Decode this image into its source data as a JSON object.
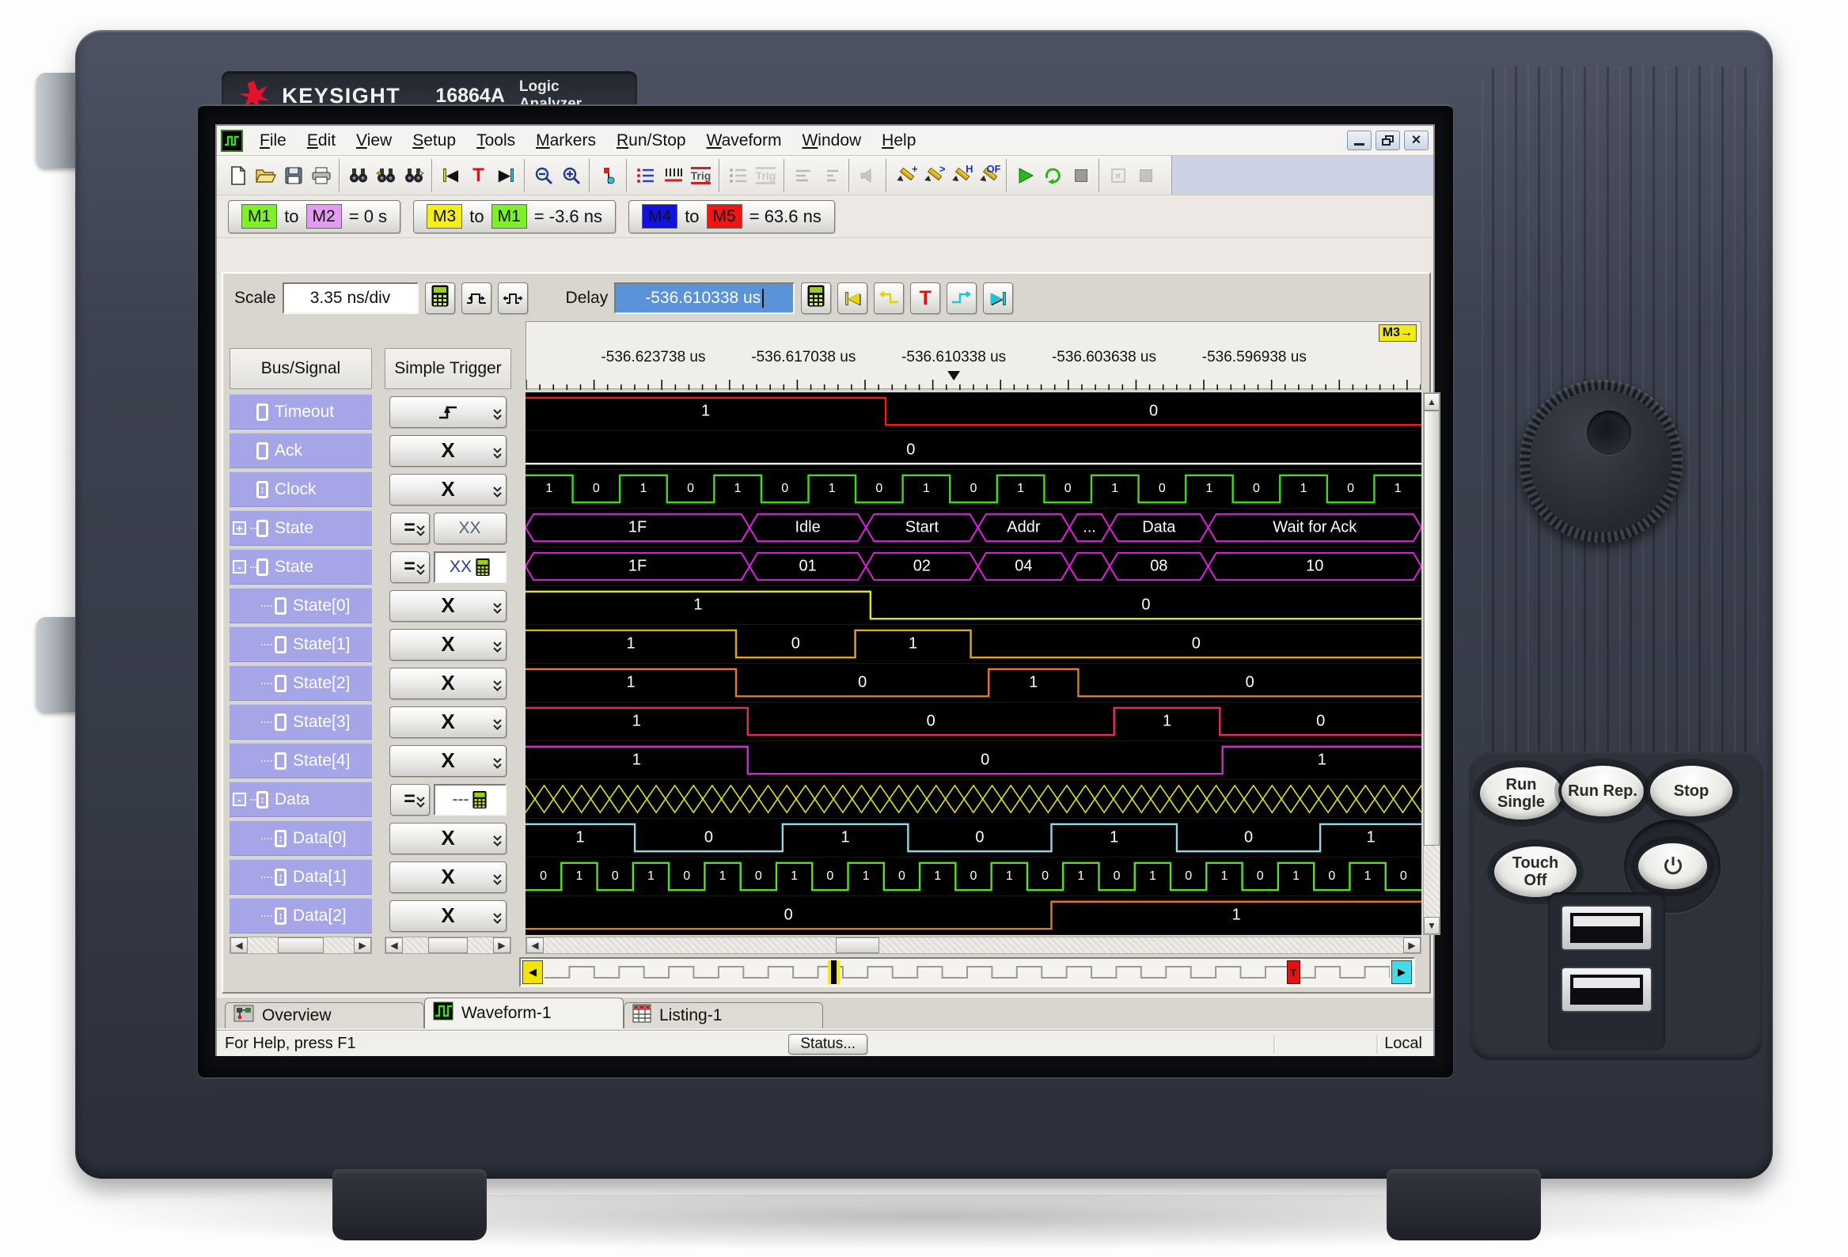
{
  "device": {
    "brand": "KEYSIGHT",
    "model": "16864A",
    "product": "Logic Analyzer",
    "hard_keys": [
      {
        "id": "run-single",
        "lines": [
          "Run",
          "Single"
        ]
      },
      {
        "id": "run-rep",
        "lines": [
          "Run Rep."
        ]
      },
      {
        "id": "stop",
        "lines": [
          "Stop"
        ]
      },
      {
        "id": "touch-off",
        "lines": [
          "Touch",
          "Off"
        ]
      }
    ]
  },
  "window": {
    "menu": [
      "File",
      "Edit",
      "View",
      "Setup",
      "Tools",
      "Markers",
      "Run/Stop",
      "Waveform",
      "Window",
      "Help"
    ],
    "window_controls": [
      "minimize",
      "restore",
      "close"
    ],
    "toolbar_groups": [
      {
        "disabled": false,
        "icons": [
          {
            "name": "new-file-icon"
          },
          {
            "name": "open-file-icon"
          },
          {
            "name": "save-icon"
          },
          {
            "name": "print-icon"
          }
        ]
      },
      {
        "disabled": false,
        "icons": [
          {
            "name": "find-icon"
          },
          {
            "name": "find-previous-icon"
          },
          {
            "name": "find-next-icon"
          }
        ]
      },
      {
        "disabled": false,
        "icons": [
          {
            "name": "goto-start-icon"
          },
          {
            "name": "goto-trigger-icon",
            "text": "T"
          },
          {
            "name": "goto-end-icon"
          }
        ]
      },
      {
        "disabled": false,
        "icons": [
          {
            "name": "zoom-out-icon"
          },
          {
            "name": "zoom-in-icon"
          }
        ]
      },
      {
        "disabled": false,
        "icons": [
          {
            "name": "marker-tool-icon"
          }
        ]
      },
      {
        "disabled": false,
        "icons": [
          {
            "name": "bus-signal-setup-icon"
          },
          {
            "name": "sampling-setup-icon"
          },
          {
            "name": "trigger-setup-icon",
            "text": "Trig"
          }
        ]
      },
      {
        "disabled": true,
        "icons": [
          {
            "name": "secondary-setup-disabled-icon"
          },
          {
            "name": "secondary-trigger-disabled-icon",
            "text": "Trig"
          }
        ]
      },
      {
        "disabled": true,
        "icons": [
          {
            "name": "format-list-disabled-icon"
          },
          {
            "name": "format-list-2-disabled-icon"
          }
        ]
      },
      {
        "disabled": true,
        "icons": [
          {
            "name": "speaker-disabled-icon"
          }
        ]
      },
      {
        "disabled": false,
        "icons": [
          {
            "name": "marker-pen-add-icon",
            "text": "+"
          },
          {
            "name": "marker-pen-next-icon",
            "text": ">"
          },
          {
            "name": "marker-pen-h-icon",
            "text": "H"
          },
          {
            "name": "marker-pen-of-icon",
            "text": "OF"
          }
        ]
      },
      {
        "disabled": false,
        "icons": [
          {
            "name": "run-icon"
          },
          {
            "name": "run-repetitive-icon"
          },
          {
            "name": "stop-acquisition-disabled-icon"
          }
        ]
      },
      {
        "disabled": true,
        "icons": [
          {
            "name": "cancel-disabled-icon"
          },
          {
            "name": "pause-disabled-icon"
          }
        ]
      }
    ],
    "markers": [
      {
        "from": "M1",
        "from_color": "#7df02a",
        "to_word": "to",
        "to": "M2",
        "to_color": "#e49bf2",
        "equals": "= 0 s"
      },
      {
        "from": "M3",
        "from_color": "#f4ee1e",
        "to_word": "to",
        "to": "M1",
        "to_color": "#7df02a",
        "equals": "= -3.6 ns"
      },
      {
        "from": "M4",
        "from_color": "#1212e0",
        "to_word": "to",
        "to": "M5",
        "to_color": "#ee1515",
        "equals": "= 63.6 ns"
      }
    ],
    "scale": {
      "label": "Scale",
      "value": "3.35 ns/div"
    },
    "delay": {
      "label": "Delay",
      "value": "-536.610338 us"
    },
    "columns": {
      "bus_signal": "Bus/Signal",
      "trigger": "Simple Trigger"
    },
    "timeline": {
      "labels": [
        "-536.623738 us",
        "-536.617038 us",
        "-536.610338 us",
        "-536.603638 us",
        "-536.596938 us"
      ],
      "positions": [
        0.142,
        0.31,
        0.478,
        0.646,
        0.814
      ],
      "trigger_pos": 0.478,
      "marker_chip": "M3→"
    },
    "signals": [
      {
        "name": "Timeout",
        "level": 0,
        "icon": "bit",
        "expand": null,
        "trigger": {
          "type": "edge"
        },
        "wave": {
          "kind": "digital",
          "color": "#ff1515",
          "segs": [
            [
              1,
              0,
              0.402,
              "1"
            ],
            [
              0,
              0.402,
              1,
              "0"
            ]
          ]
        }
      },
      {
        "name": "Ack",
        "level": 0,
        "icon": "bit",
        "expand": null,
        "trigger": {
          "type": "any",
          "symbol": "X"
        },
        "wave": {
          "kind": "digital",
          "color": "#ffffff",
          "segs": [
            [
              0,
              0,
              1,
              "0",
              0.43
            ]
          ]
        }
      },
      {
        "name": "Clock",
        "level": 0,
        "icon": "bit-ud",
        "expand": null,
        "trigger": {
          "type": "any",
          "symbol": "X"
        },
        "wave": {
          "kind": "clock",
          "color": "#3fdc18",
          "halves": 19,
          "start": 1
        }
      },
      {
        "name": "State",
        "level": 0,
        "icon": "bit",
        "expand": "+",
        "trigger": {
          "type": "equals",
          "symbol": "=",
          "value": "XX",
          "editable": false
        },
        "wave": {
          "kind": "bus",
          "color": "#e020e0",
          "segs": [
            [
              0,
              0.25,
              "1F"
            ],
            [
              0.25,
              0.38,
              "Idle"
            ],
            [
              0.38,
              0.505,
              "Start"
            ],
            [
              0.505,
              0.607,
              "Addr"
            ],
            [
              0.607,
              0.652,
              "..."
            ],
            [
              0.652,
              0.762,
              "Data"
            ],
            [
              0.762,
              1,
              "Wait for Ack"
            ]
          ]
        }
      },
      {
        "name": "State",
        "level": 0,
        "icon": "bit",
        "expand": "-",
        "trigger": {
          "type": "equals",
          "symbol": "=",
          "value": "XX",
          "editable": true
        },
        "wave": {
          "kind": "bus",
          "color": "#e020e0",
          "segs": [
            [
              0,
              0.25,
              "1F"
            ],
            [
              0.25,
              0.38,
              "01"
            ],
            [
              0.38,
              0.505,
              "02"
            ],
            [
              0.505,
              0.607,
              "04"
            ],
            [
              0.607,
              0.652,
              ""
            ],
            [
              0.652,
              0.762,
              "08"
            ],
            [
              0.762,
              1,
              "10"
            ]
          ]
        }
      },
      {
        "name": "State[0]",
        "level": 1,
        "icon": "bit",
        "expand": null,
        "trigger": {
          "type": "any",
          "symbol": "X"
        },
        "wave": {
          "kind": "digital",
          "color": "#e3e316",
          "segs": [
            [
              1,
              0,
              0.385,
              "1"
            ],
            [
              0,
              0.385,
              1,
              "0"
            ]
          ]
        }
      },
      {
        "name": "State[1]",
        "level": 1,
        "icon": "bit",
        "expand": null,
        "trigger": {
          "type": "any",
          "symbol": "X"
        },
        "wave": {
          "kind": "digital",
          "color": "#e0a81c",
          "segs": [
            [
              1,
              0,
              0.235,
              "1"
            ],
            [
              0,
              0.235,
              0.368,
              "0"
            ],
            [
              1,
              0.368,
              0.497,
              "1"
            ],
            [
              0,
              0.497,
              1,
              "0"
            ]
          ]
        }
      },
      {
        "name": "State[2]",
        "level": 1,
        "icon": "bit",
        "expand": null,
        "trigger": {
          "type": "any",
          "symbol": "X"
        },
        "wave": {
          "kind": "digital",
          "color": "#e27a20",
          "segs": [
            [
              1,
              0,
              0.235,
              "1"
            ],
            [
              0,
              0.235,
              0.517,
              "0"
            ],
            [
              1,
              0.517,
              0.617,
              "1"
            ],
            [
              0,
              0.617,
              1,
              "0"
            ]
          ]
        }
      },
      {
        "name": "State[3]",
        "level": 1,
        "icon": "bit",
        "expand": null,
        "trigger": {
          "type": "any",
          "symbol": "X"
        },
        "wave": {
          "kind": "digital",
          "color": "#e82860",
          "segs": [
            [
              1,
              0,
              0.248,
              "1"
            ],
            [
              0,
              0.248,
              0.657,
              "0"
            ],
            [
              1,
              0.657,
              0.775,
              "1"
            ],
            [
              0,
              0.775,
              1,
              "0"
            ]
          ]
        }
      },
      {
        "name": "State[4]",
        "level": 1,
        "icon": "bit",
        "expand": null,
        "trigger": {
          "type": "any",
          "symbol": "X"
        },
        "wave": {
          "kind": "digital",
          "color": "#cd2ccd",
          "segs": [
            [
              1,
              0,
              0.248,
              "1"
            ],
            [
              0,
              0.248,
              0.778,
              "0"
            ],
            [
              1,
              0.778,
              1,
              "1"
            ]
          ]
        }
      },
      {
        "name": "Data",
        "level": 0,
        "icon": "bit-ud",
        "expand": "-",
        "trigger": {
          "type": "equals",
          "symbol": "=",
          "value": "---",
          "editable": true
        },
        "wave": {
          "kind": "hatch",
          "color": "#e3e316",
          "n": 48
        }
      },
      {
        "name": "Data[0]",
        "level": 1,
        "icon": "bit-ud",
        "expand": null,
        "trigger": {
          "type": "any",
          "symbol": "X"
        },
        "wave": {
          "kind": "digital",
          "color": "#8fd8ea",
          "segs": [
            [
              1,
              0,
              0.122,
              "1"
            ],
            [
              0,
              0.122,
              0.287,
              "0"
            ],
            [
              1,
              0.287,
              0.427,
              "1"
            ],
            [
              0,
              0.427,
              0.587,
              "0"
            ],
            [
              1,
              0.587,
              0.727,
              "1"
            ],
            [
              0,
              0.727,
              0.887,
              "0"
            ],
            [
              1,
              0.887,
              1,
              "1"
            ]
          ]
        }
      },
      {
        "name": "Data[1]",
        "level": 1,
        "icon": "bit-ud",
        "expand": null,
        "trigger": {
          "type": "any",
          "symbol": "X"
        },
        "wave": {
          "kind": "clock",
          "color": "#55e022",
          "halves": 25,
          "start": 0
        }
      },
      {
        "name": "Data[2]",
        "level": 1,
        "icon": "bit-ud",
        "expand": null,
        "trigger": {
          "type": "any",
          "symbol": "X"
        },
        "wave": {
          "kind": "digital",
          "color": "#e27a20",
          "segs": [
            [
              0,
              0,
              0.587,
              "0"
            ],
            [
              1,
              0.587,
              1,
              "1"
            ]
          ]
        }
      }
    ],
    "nav_overview": {
      "cursor_pos": 0.335,
      "trigger_pos": 0.878,
      "trigger_label": "T"
    },
    "tabs": [
      {
        "label": "Overview",
        "icon": "overview-icon",
        "active": false
      },
      {
        "label": "Waveform-1",
        "icon": "waveform-icon",
        "active": true
      },
      {
        "label": "Listing-1",
        "icon": "listing-icon",
        "active": false
      }
    ],
    "status": {
      "help": "For Help, press F1",
      "button": "Status...",
      "mode": "Local"
    }
  }
}
